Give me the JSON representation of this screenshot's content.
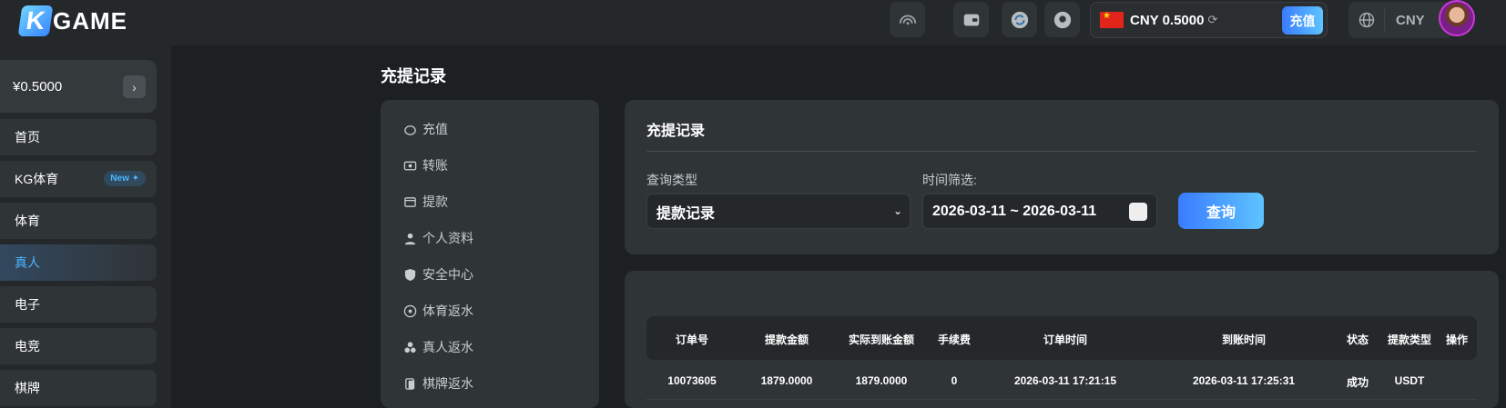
{
  "topbar": {
    "logo_letter": "K",
    "logo_rest": "GAME",
    "balance": "CNY 0.5000",
    "deposit_label": "充值",
    "currency": "CNY"
  },
  "sidebar": {
    "balance": "¥0.5000",
    "items": [
      {
        "label": "首页"
      },
      {
        "label": "KG体育",
        "badge": "New ✦"
      },
      {
        "label": "体育"
      },
      {
        "label": "真人",
        "active": true
      },
      {
        "label": "电子"
      },
      {
        "label": "电竞"
      },
      {
        "label": "棋牌"
      }
    ]
  },
  "page": {
    "title": "充提记录"
  },
  "account_menu": {
    "items": [
      {
        "label": "充值",
        "icon": "piggy-bank-icon"
      },
      {
        "label": "转账",
        "icon": "transfer-icon"
      },
      {
        "label": "提款",
        "icon": "withdraw-icon"
      },
      {
        "label": "个人资料",
        "icon": "user-icon"
      },
      {
        "label": "安全中心",
        "icon": "shield-icon"
      },
      {
        "label": "体育返水",
        "icon": "soccer-ball-icon"
      },
      {
        "label": "真人返水",
        "icon": "chips-icon"
      },
      {
        "label": "棋牌返水",
        "icon": "cards-icon"
      }
    ]
  },
  "filter": {
    "title": "充提记录",
    "query_type_label": "查询类型",
    "query_type_value": "提款记录",
    "time_label": "时间筛选:",
    "date_range": "2026-03-11 ~ 2026-03-11",
    "query_button": "查询"
  },
  "table": {
    "headers": [
      "订单号",
      "提款金额",
      "实际到账金额",
      "手续费",
      "订单时间",
      "到账时间",
      "状态",
      "提款类型",
      "操作"
    ],
    "rows": [
      [
        "10073605",
        "1879.0000",
        "1879.0000",
        "0",
        "2026-03-11 17:21:15",
        "2026-03-11 17:25:31",
        "成功",
        "USDT",
        ""
      ]
    ]
  },
  "colors": {
    "accent": "#3a7bff",
    "accent_light": "#5dc4ff",
    "active_text": "#4db6ff",
    "background": "#1d2023",
    "panel": "#2f3437"
  }
}
